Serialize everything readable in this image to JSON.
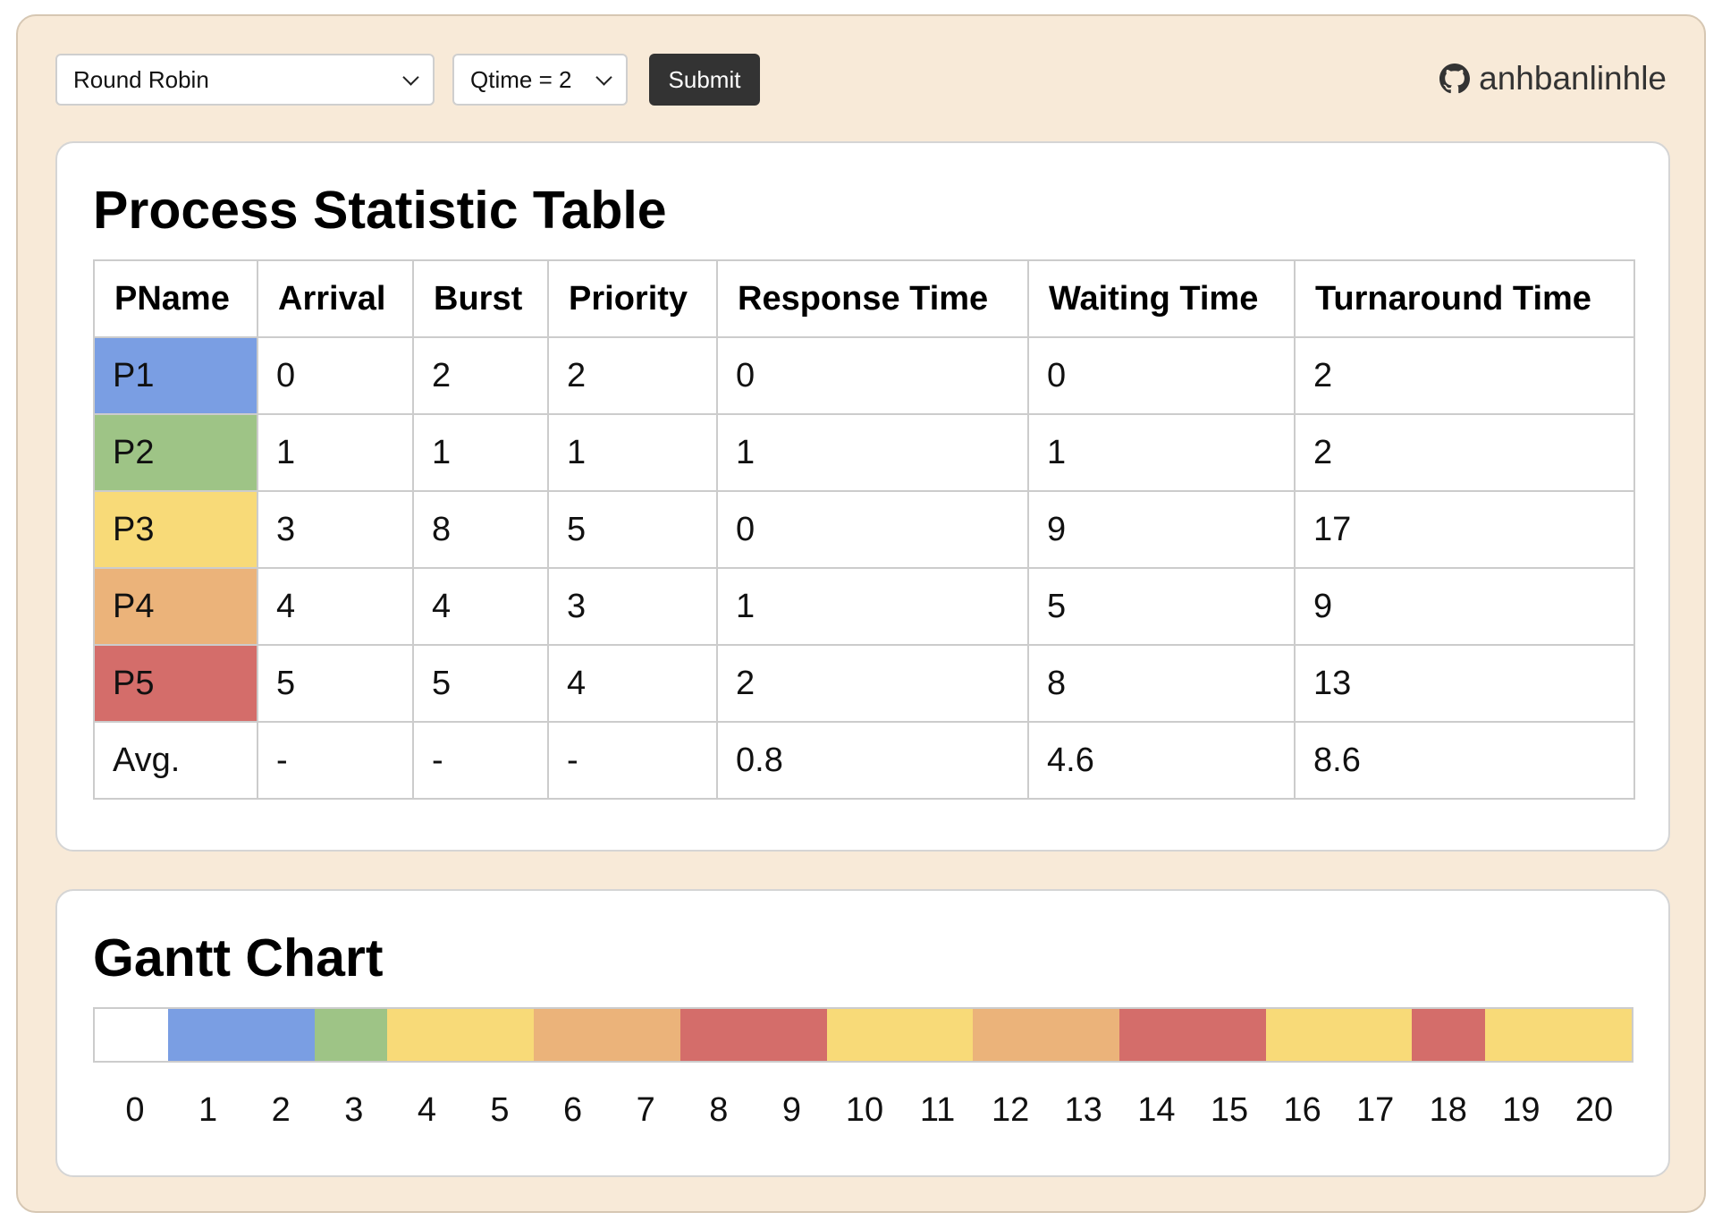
{
  "toolbar": {
    "algorithm": "Round Robin",
    "qtime": "Qtime = 2",
    "submit_label": "Submit",
    "username": "anhbanlinhle"
  },
  "stats": {
    "title": "Process Statistic Table",
    "columns": [
      "PName",
      "Arrival",
      "Burst",
      "Priority",
      "Response Time",
      "Waiting Time",
      "Turnaround Time"
    ],
    "rows": [
      {
        "name": "P1",
        "color": "#7a9ee3",
        "cells": [
          "0",
          "2",
          "2",
          "0",
          "0",
          "2"
        ]
      },
      {
        "name": "P2",
        "color": "#9ec486",
        "cells": [
          "1",
          "1",
          "1",
          "1",
          "1",
          "2"
        ]
      },
      {
        "name": "P3",
        "color": "#f8da78",
        "cells": [
          "3",
          "8",
          "5",
          "0",
          "9",
          "17"
        ]
      },
      {
        "name": "P4",
        "color": "#ebb37a",
        "cells": [
          "4",
          "4",
          "3",
          "1",
          "5",
          "9"
        ]
      },
      {
        "name": "P5",
        "color": "#d46d6a",
        "cells": [
          "5",
          "5",
          "4",
          "2",
          "8",
          "13"
        ]
      }
    ],
    "avg": {
      "name": "Avg.",
      "cells": [
        "-",
        "-",
        "-",
        "0.8",
        "4.6",
        "8.6"
      ]
    }
  },
  "gantt": {
    "title": "Gantt Chart",
    "ticks": [
      "0",
      "1",
      "2",
      "3",
      "4",
      "5",
      "6",
      "7",
      "8",
      "9",
      "10",
      "11",
      "12",
      "13",
      "14",
      "15",
      "16",
      "17",
      "18",
      "19",
      "20"
    ],
    "segments": [
      {
        "process": "idle",
        "start": 0,
        "end": 1,
        "color": "#ffffff"
      },
      {
        "process": "P1",
        "start": 1,
        "end": 3,
        "color": "#7a9ee3"
      },
      {
        "process": "P2",
        "start": 3,
        "end": 4,
        "color": "#9ec486"
      },
      {
        "process": "P3",
        "start": 4,
        "end": 6,
        "color": "#f8da78"
      },
      {
        "process": "P4",
        "start": 6,
        "end": 8,
        "color": "#ebb37a"
      },
      {
        "process": "P5",
        "start": 8,
        "end": 10,
        "color": "#d46d6a"
      },
      {
        "process": "P3",
        "start": 10,
        "end": 12,
        "color": "#f8da78"
      },
      {
        "process": "P4",
        "start": 12,
        "end": 14,
        "color": "#ebb37a"
      },
      {
        "process": "P5",
        "start": 14,
        "end": 16,
        "color": "#d46d6a"
      },
      {
        "process": "P3",
        "start": 16,
        "end": 18,
        "color": "#f8da78"
      },
      {
        "process": "P5",
        "start": 18,
        "end": 19,
        "color": "#d46d6a"
      },
      {
        "process": "P3",
        "start": 19,
        "end": 21,
        "color": "#f8da78"
      }
    ]
  }
}
